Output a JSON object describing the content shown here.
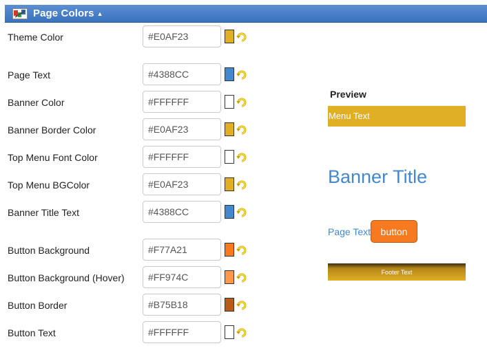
{
  "header": {
    "title": "Page Colors"
  },
  "fields": [
    {
      "label": "Theme Color",
      "value": "#E0AF23",
      "swatch": "#E0AF23"
    },
    {
      "label": "Page Text",
      "value": "#4388CC",
      "swatch": "#4388CC"
    },
    {
      "label": "Banner Color",
      "value": "#FFFFFF",
      "swatch": "#FFFFFF"
    },
    {
      "label": "Banner Border Color",
      "value": "#E0AF23",
      "swatch": "#E0AF23"
    },
    {
      "label": "Top Menu Font Color",
      "value": "#FFFFFF",
      "swatch": "#FFFFFF"
    },
    {
      "label": "Top Menu BGColor",
      "value": "#E0AF23",
      "swatch": "#E0AF23"
    },
    {
      "label": "Banner Title Text",
      "value": "#4388CC",
      "swatch": "#4388CC"
    },
    {
      "label": "Button Background",
      "value": "#F77A21",
      "swatch": "#F77A21"
    },
    {
      "label": "Button Background (Hover)",
      "value": "#FF974C",
      "swatch": "#FF974C"
    },
    {
      "label": "Button Border",
      "value": "#B75B18",
      "swatch": "#B75B18"
    },
    {
      "label": "Button Text",
      "value": "#FFFFFF",
      "swatch": "#FFFFFF"
    }
  ],
  "preview": {
    "label": "Preview",
    "menu_text": "Menu Text",
    "banner_title": "Banner Title",
    "page_text": "Page Text",
    "button_label": "button",
    "footer_text": "Footer Text"
  },
  "colors": {
    "header_bg": "#3a72bd",
    "theme": "#E0AF23",
    "page_text": "#4388CC",
    "menu_font": "#FFFFFF",
    "menu_bg": "#E0AF23",
    "banner_title": "#4388CC",
    "button_bg": "#F77A21",
    "button_border": "#B75B18",
    "button_text": "#FFFFFF"
  },
  "icons": {
    "logo": "palette-logo-icon",
    "caret": "caret-up-icon",
    "reset": "reset-undo-icon"
  }
}
